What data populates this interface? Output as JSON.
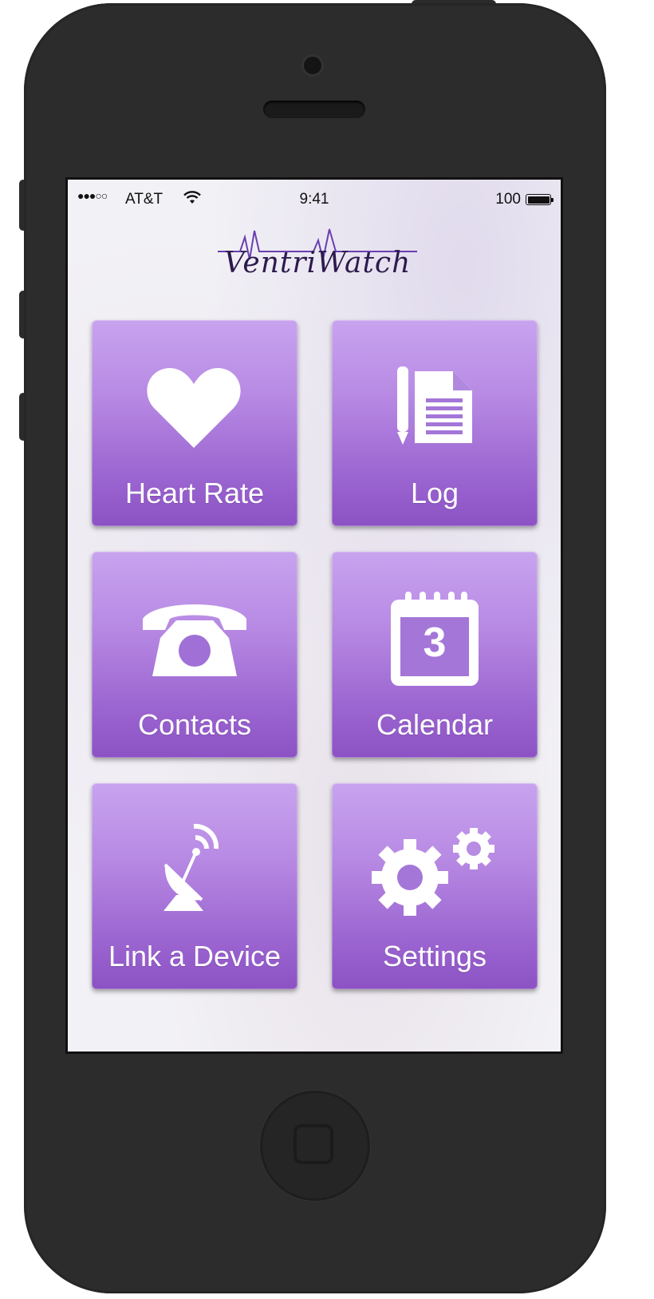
{
  "status_bar": {
    "signal": "●●●○○",
    "carrier": "AT&T",
    "time": "9:41",
    "battery": "100"
  },
  "app": {
    "logo_text": "VentriWatch"
  },
  "colors": {
    "tile_top": "#c8a3ef",
    "tile_bottom": "#8c52c4",
    "logo": "#2d1a4d",
    "logo_pulse": "#6a3fb0"
  },
  "tiles": [
    {
      "label": "Heart Rate",
      "icon": "heart-icon"
    },
    {
      "label": "Log",
      "icon": "document-pencil-icon"
    },
    {
      "label": "Contacts",
      "icon": "phone-icon"
    },
    {
      "label": "Calendar",
      "icon": "calendar-icon",
      "icon_text": "3"
    },
    {
      "label": "Link a Device",
      "icon": "satellite-dish-icon"
    },
    {
      "label": "Settings",
      "icon": "gears-icon"
    }
  ]
}
